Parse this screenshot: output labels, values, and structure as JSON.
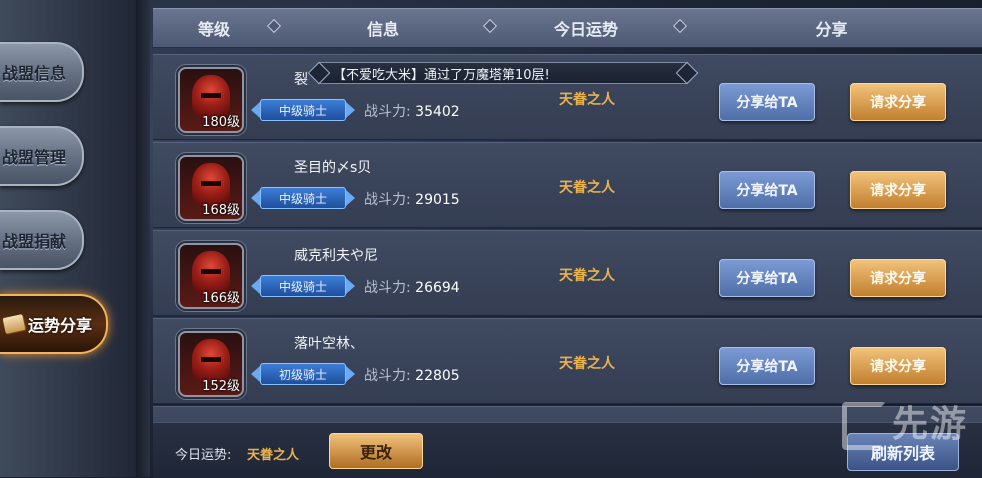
{
  "sidebar": {
    "tabs": [
      {
        "label": "战盟信息"
      },
      {
        "label": "战盟管理"
      },
      {
        "label": "战盟捐献"
      },
      {
        "label": "运势分享"
      }
    ]
  },
  "header": {
    "columns": [
      "等级",
      "信息",
      "今日运势",
      "分享"
    ]
  },
  "notice": {
    "text": "【不爱吃大米】通过了万魔塔第10层!"
  },
  "rows": [
    {
      "level": "180级",
      "name": "裂",
      "rank": "中级骑士",
      "power_label": "战斗力:",
      "power": "35402",
      "fortune": "天眷之人",
      "share_btn": "分享给TA",
      "request_btn": "请求分享"
    },
    {
      "level": "168级",
      "name": "圣目的〆s贝",
      "rank": "中级骑士",
      "power_label": "战斗力:",
      "power": "29015",
      "fortune": "天眷之人",
      "share_btn": "分享给TA",
      "request_btn": "请求分享"
    },
    {
      "level": "166级",
      "name": "威克利夫や尼",
      "rank": "中级骑士",
      "power_label": "战斗力:",
      "power": "26694",
      "fortune": "天眷之人",
      "share_btn": "分享给TA",
      "request_btn": "请求分享"
    },
    {
      "level": "152级",
      "name": "落叶空林、",
      "rank": "初级骑士",
      "power_label": "战斗力:",
      "power": "22805",
      "fortune": "天眷之人",
      "share_btn": "分享给TA",
      "request_btn": "请求分享"
    }
  ],
  "footer": {
    "label": "今日运势:",
    "value": "天眷之人",
    "change_btn": "更改",
    "refresh_btn": "刷新列表"
  },
  "watermark": {
    "text": "先游",
    "icon": "g-logo-icon"
  },
  "colors": {
    "gold": "#e8b24e",
    "accent_blue": "#4f6ea8",
    "accent_gold": "#c27f2e"
  }
}
